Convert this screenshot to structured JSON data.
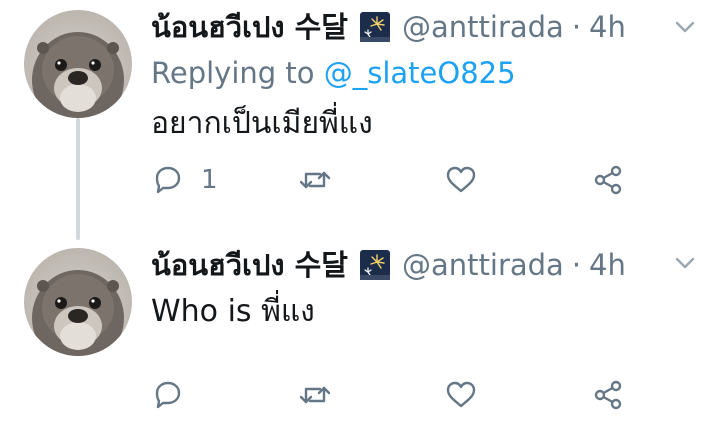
{
  "tweets": [
    {
      "author": {
        "name": "น้อนฮวีเปง 수달",
        "handle": "@anttirada"
      },
      "separator": "·",
      "time": "4h",
      "replying": {
        "prefix": "Replying to ",
        "mention": "@_slateO825"
      },
      "text": "อยากเป็นเมียพี่แง",
      "actions": {
        "reply_count": "1",
        "retweet_count": "",
        "like_count": ""
      }
    },
    {
      "author": {
        "name": "น้อนฮวีเปง 수달",
        "handle": "@anttirada"
      },
      "separator": "·",
      "time": "4h",
      "text": "Who is พี่แง",
      "actions": {
        "reply_count": "",
        "retweet_count": "",
        "like_count": ""
      }
    }
  ],
  "icons": {
    "emoji": "fireworks-emoji",
    "reply": "reply-icon",
    "retweet": "retweet-icon",
    "like": "heart-icon",
    "share": "share-icon",
    "menu": "chevron-down-icon"
  },
  "colors": {
    "text": "#14171a",
    "secondary": "#657786",
    "link": "#1da1f2",
    "thread_line": "#cfd9de"
  }
}
